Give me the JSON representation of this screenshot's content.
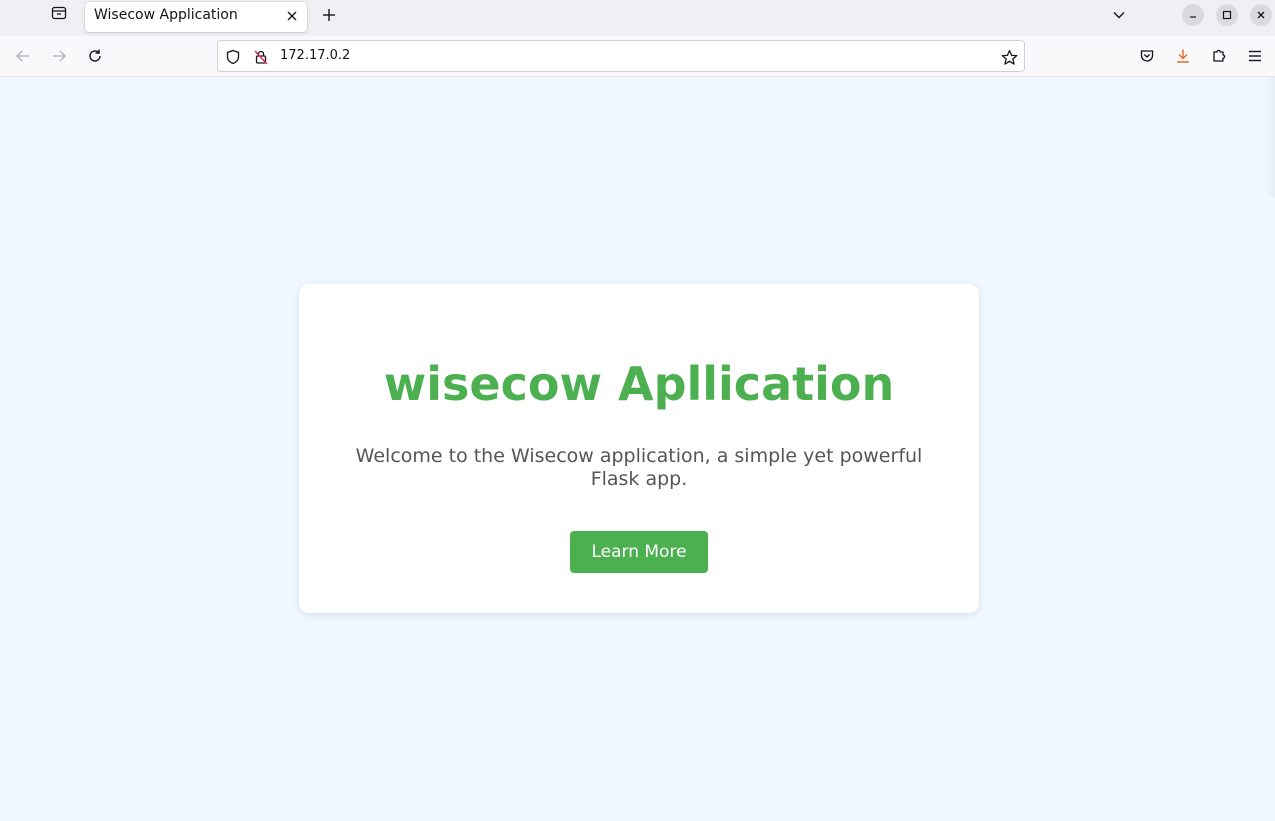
{
  "browser": {
    "tabs": [
      {
        "title": "Wisecow Application",
        "active": true
      }
    ],
    "url": "172.17.0.2",
    "icons": {
      "tab_list": "tab-list-icon",
      "close_tab": "close-icon",
      "new_tab": "plus-icon",
      "tab_overflow": "chevron-down-icon",
      "back": "arrow-left-icon",
      "forward": "arrow-right-icon",
      "reload": "reload-icon",
      "tracking_protection": "shield-icon",
      "insecure": "lock-slash-icon",
      "bookmark": "star-icon",
      "pocket": "pocket-icon",
      "downloads": "download-icon",
      "extensions": "puzzle-icon",
      "menu": "hamburger-icon"
    },
    "colors": {
      "download_accent": "#e3712b"
    }
  },
  "page": {
    "background": "#f0f7ff",
    "card": {
      "title": "wisecow Apllication",
      "text": "Welcome to the Wisecow application, a simple yet powerful Flask app.",
      "button_label": "Learn More"
    },
    "colors": {
      "accent": "#4caf50",
      "body_text": "#555555"
    }
  }
}
